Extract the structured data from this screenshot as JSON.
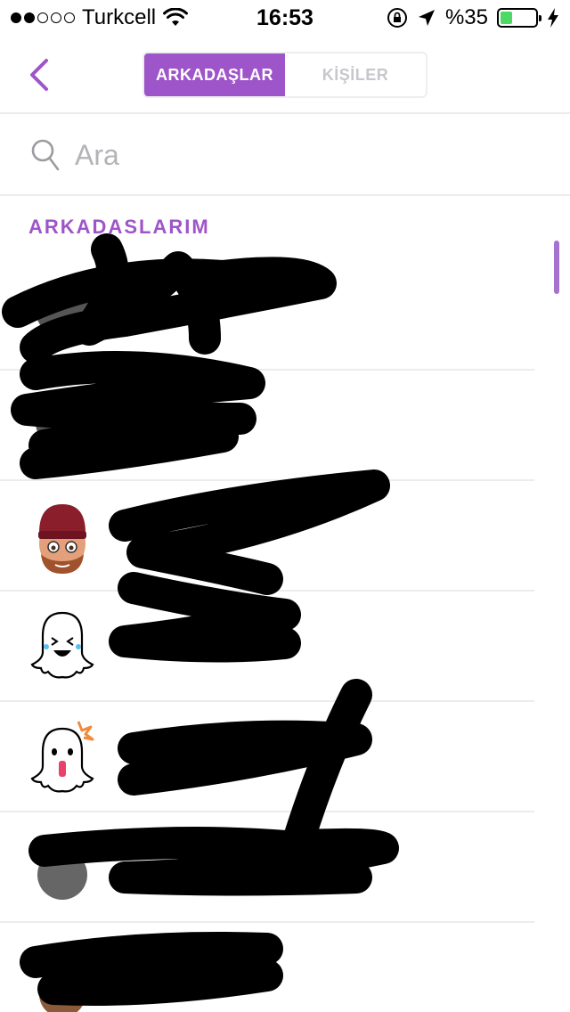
{
  "status_bar": {
    "carrier": "Turkcell",
    "time": "16:53",
    "battery_percent_label": "%35",
    "battery_level": 0.35,
    "signal_bars_filled": 2,
    "signal_bars_total": 5
  },
  "nav": {
    "tabs": [
      {
        "label": "ARKADAŞLAR",
        "active": true
      },
      {
        "label": "KİŞİLER",
        "active": false
      }
    ]
  },
  "search": {
    "placeholder": "Ara"
  },
  "section": {
    "title": "ARKADASLARIM"
  },
  "colors": {
    "accent": "#9e55c9",
    "battery": "#4cd964",
    "divider": "#ececec"
  },
  "friends": [
    {
      "avatar": "redacted-avatar"
    },
    {
      "avatar": "redacted-avatar"
    },
    {
      "avatar": "bitmoji-avatar"
    },
    {
      "avatar": "ghost-laughing-icon"
    },
    {
      "avatar": "ghost-surprised-icon"
    },
    {
      "avatar": "redacted-avatar"
    },
    {
      "avatar": "redacted-avatar"
    }
  ]
}
